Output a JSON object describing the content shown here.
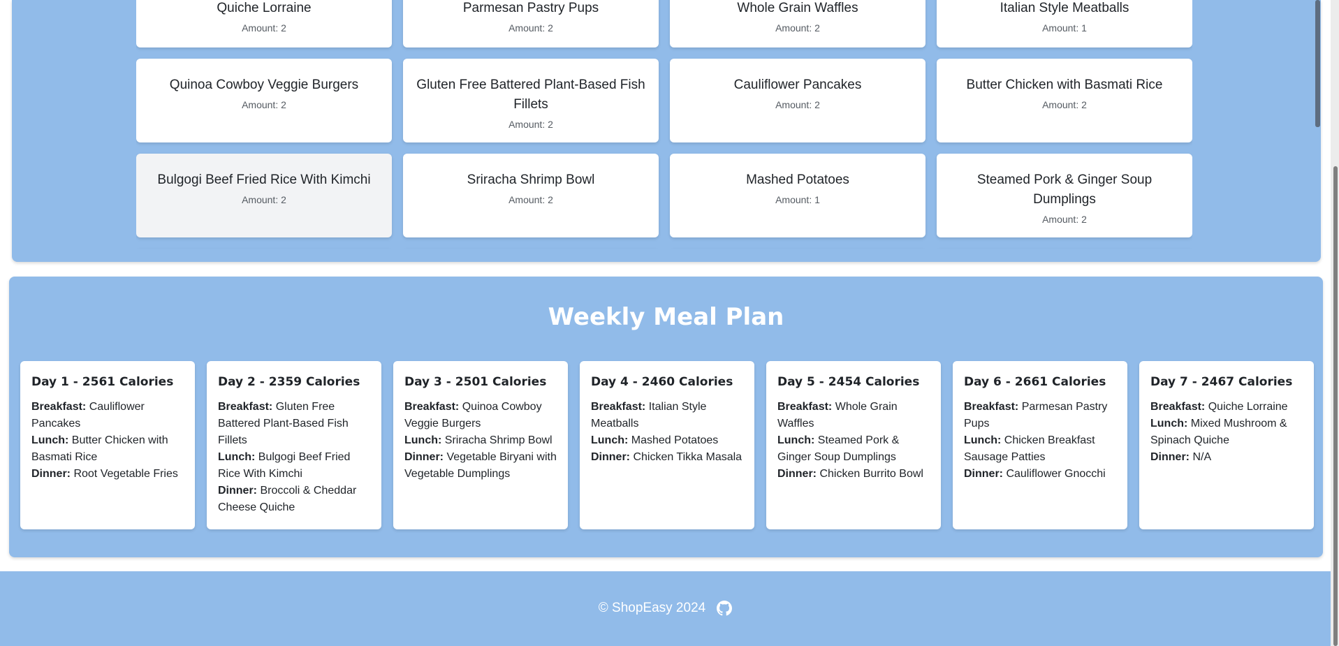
{
  "inventory": {
    "amount_label": "Amount:",
    "rows": [
      [
        {
          "name": "Quiche Lorraine",
          "amount": "Amount: 2"
        },
        {
          "name": "Parmesan Pastry Pups",
          "amount": "Amount: 2"
        },
        {
          "name": "Whole Grain Waffles",
          "amount": "Amount: 2"
        },
        {
          "name": "Italian Style Meatballs",
          "amount": "Amount: 1"
        }
      ],
      [
        {
          "name": "Quinoa Cowboy Veggie Burgers",
          "amount": "Amount: 2"
        },
        {
          "name": "Gluten Free Battered Plant-Based Fish Fillets",
          "amount": "Amount: 2"
        },
        {
          "name": "Cauliflower Pancakes",
          "amount": "Amount: 2"
        },
        {
          "name": "Butter Chicken with Basmati Rice",
          "amount": "Amount: 2"
        }
      ],
      [
        {
          "name": "Bulgogi Beef Fried Rice With Kimchi",
          "amount": "Amount: 2"
        },
        {
          "name": "Sriracha Shrimp Bowl",
          "amount": "Amount: 2"
        },
        {
          "name": "Mashed Potatoes",
          "amount": "Amount: 1"
        },
        {
          "name": "Steamed Pork & Ginger Soup Dumplings",
          "amount": "Amount: 2"
        }
      ]
    ]
  },
  "meal_plan": {
    "title": "Weekly Meal Plan",
    "labels": {
      "breakfast": "Breakfast:",
      "lunch": "Lunch:",
      "dinner": "Dinner:"
    },
    "days": [
      {
        "heading": "Day 1 - 2561 Calories",
        "breakfast": "Cauliflower Pancakes",
        "lunch": "Butter Chicken with Basmati Rice",
        "dinner": "Root Vegetable Fries"
      },
      {
        "heading": "Day 2 - 2359 Calories",
        "breakfast": "Gluten Free Battered Plant-Based Fish Fillets",
        "lunch": "Bulgogi Beef Fried Rice With Kimchi",
        "dinner": "Broccoli & Cheddar Cheese Quiche"
      },
      {
        "heading": "Day 3 - 2501 Calories",
        "breakfast": "Quinoa Cowboy Veggie Burgers",
        "lunch": "Sriracha Shrimp Bowl",
        "dinner": "Vegetable Biryani with Vegetable Dumplings"
      },
      {
        "heading": "Day 4 - 2460 Calories",
        "breakfast": "Italian Style Meatballs",
        "lunch": "Mashed Potatoes",
        "dinner": "Chicken Tikka Masala"
      },
      {
        "heading": "Day 5 - 2454 Calories",
        "breakfast": "Whole Grain Waffles",
        "lunch": "Steamed Pork & Ginger Soup Dumplings",
        "dinner": "Chicken Burrito Bowl"
      },
      {
        "heading": "Day 6 - 2661 Calories",
        "breakfast": "Parmesan Pastry Pups",
        "lunch": "Chicken Breakfast Sausage Patties",
        "dinner": "Cauliflower Gnocchi"
      },
      {
        "heading": "Day 7 - 2467 Calories",
        "breakfast": "Quiche Lorraine",
        "lunch": "Mixed Mushroom & Spinach Quiche",
        "dinner": "N/A"
      }
    ]
  },
  "footer": {
    "copyright": "© ShopEasy 2024",
    "icon": "github-icon"
  },
  "colors": {
    "panel_blue": "#91bbe9",
    "card_white": "#ffffff",
    "hover_gray": "#f2f3f5"
  }
}
